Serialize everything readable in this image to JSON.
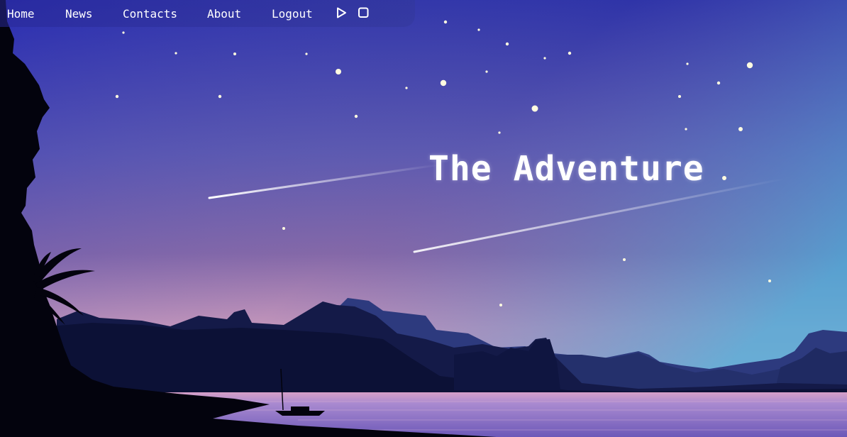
{
  "nav": {
    "items": [
      {
        "label": "Home"
      },
      {
        "label": "News"
      },
      {
        "label": "Contacts"
      },
      {
        "label": "About"
      },
      {
        "label": "Logout"
      }
    ],
    "controls": [
      {
        "icon": "play-icon"
      },
      {
        "icon": "stop-icon"
      }
    ]
  },
  "hero": {
    "title": "The Adventure"
  },
  "colors": {
    "sky_top": "#2a2bb0",
    "sky_mid": "#7b62a8",
    "sky_horizon": "#d9a6c3",
    "sky_right_top": "#47a6d6",
    "mountain_far": "#2b3878",
    "mountain_near": "#0d1238",
    "silhouette": "#03030d",
    "water": "#8a72c4",
    "star": "#fffbe0",
    "moon": "#ffffff"
  }
}
